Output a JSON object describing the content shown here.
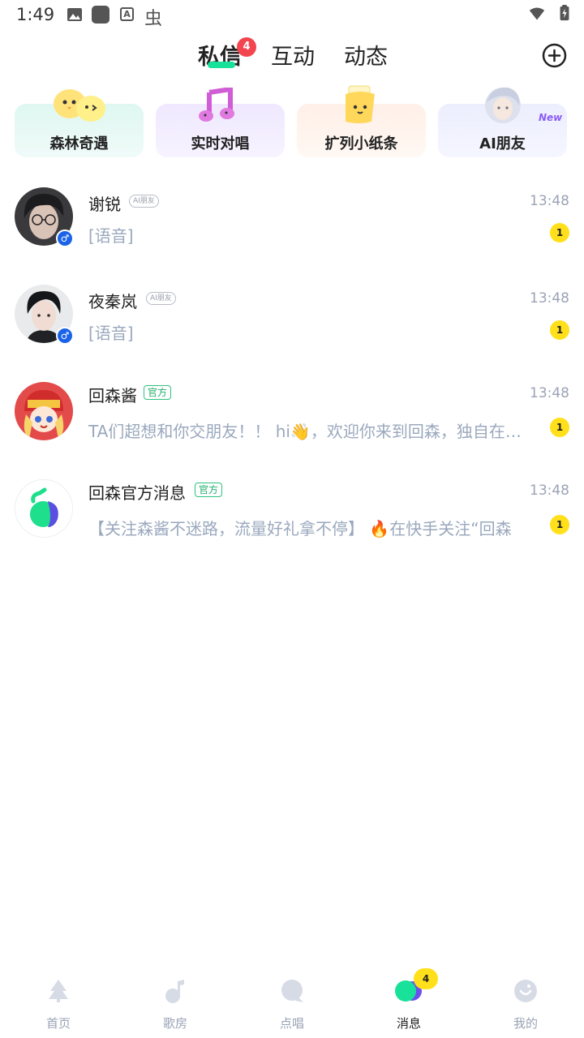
{
  "status_bar": {
    "time": "1:49"
  },
  "tabs": {
    "private_label": "私信",
    "private_badge": "4",
    "interact_label": "互动",
    "moments_label": "动态"
  },
  "features": [
    {
      "label": "森林奇遇"
    },
    {
      "label": "实时对唱"
    },
    {
      "label": "扩列小纸条"
    },
    {
      "label": "AI朋友",
      "tag": "New"
    }
  ],
  "conversations": [
    {
      "name": "谢锐",
      "tag": "AI朋友",
      "time": "13:48",
      "preview": "[语音]",
      "unread": "1"
    },
    {
      "name": "夜秦岚",
      "tag": "AI朋友",
      "time": "13:48",
      "preview": "[语音]",
      "unread": "1"
    },
    {
      "name": "回森酱",
      "tag": "官方",
      "time": "13:48",
      "preview": "TA们超想和你交朋友！！ hi👋，欢迎你来到回森，独自在家的时候",
      "unread": "1"
    },
    {
      "name": "回森官方消息",
      "tag": "官方",
      "time": "13:48",
      "preview": "【关注森酱不迷路，流量好礼拿不停】 🔥在快手关注“回森",
      "unread": "1"
    }
  ],
  "bottom_nav": {
    "home": "首页",
    "songs": "歌房",
    "sing": "点唱",
    "messages": "消息",
    "messages_badge": "4",
    "profile": "我的"
  },
  "colors": {
    "accent": "#18e19a",
    "badge_red": "#f2454f",
    "badge_yellow": "#ffe01a",
    "gender_blue": "#1a63e8",
    "official_green": "#1fb06c"
  }
}
